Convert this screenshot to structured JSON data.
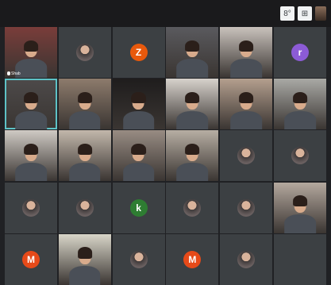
{
  "topbar": {
    "participants_icon": "people-icon",
    "chat_icon": "chat-icon",
    "participants_glyph": "8°",
    "chat_glyph": "⊞"
  },
  "colors": {
    "background": "#202124",
    "tile": "#3c4043",
    "active_outline": "#5ec2c6"
  },
  "tiles": [
    {
      "kind": "video",
      "name": "Shab",
      "bg": "#7a3d3a"
    },
    {
      "kind": "photo"
    },
    {
      "kind": "letter",
      "letter": "Z",
      "color": "#e8590c"
    },
    {
      "kind": "video",
      "bg": "#5a5a5e"
    },
    {
      "kind": "video",
      "bg": "#c9c2bc"
    },
    {
      "kind": "letter",
      "letter": "r",
      "color": "#8c5bd6"
    },
    {
      "kind": "video",
      "bg": "#4d4a4a",
      "active": true
    },
    {
      "kind": "video",
      "bg": "#8d7b6c"
    },
    {
      "kind": "video",
      "bg": "#1f1d1d"
    },
    {
      "kind": "video",
      "bg": "#d7d2cc"
    },
    {
      "kind": "video",
      "bg": "#b49f8e"
    },
    {
      "kind": "video",
      "bg": "#a9a9a5"
    },
    {
      "kind": "video",
      "bg": "#cfcac4"
    },
    {
      "kind": "video",
      "bg": "#c2b7ab"
    },
    {
      "kind": "video",
      "bg": "#988c83"
    },
    {
      "kind": "video",
      "bg": "#b7aea3"
    },
    {
      "kind": "photo"
    },
    {
      "kind": "photo"
    },
    {
      "kind": "photo"
    },
    {
      "kind": "photo"
    },
    {
      "kind": "letter",
      "letter": "k",
      "color": "#2e7d32"
    },
    {
      "kind": "photo"
    },
    {
      "kind": "photo"
    },
    {
      "kind": "video",
      "bg": "#b4a89e"
    },
    {
      "kind": "letter",
      "letter": "M",
      "color": "#e64a19"
    },
    {
      "kind": "video",
      "bg": "#d8d5c8"
    },
    {
      "kind": "photo"
    },
    {
      "kind": "letter",
      "letter": "M",
      "color": "#e64a19"
    },
    {
      "kind": "photo"
    },
    {
      "kind": "dark"
    }
  ]
}
